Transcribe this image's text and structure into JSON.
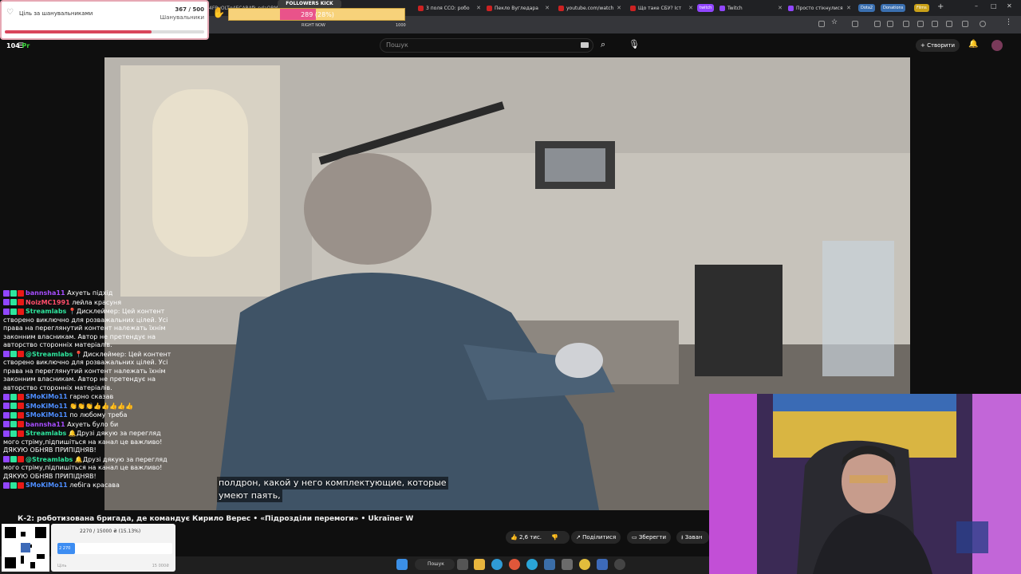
{
  "tabs": [
    {
      "label": "3 поля ССО: робо",
      "color": "#cc2222"
    },
    {
      "label": "Пекло Вугледара",
      "color": "#cc2222"
    },
    {
      "label": "youtube.com/watch",
      "color": "#cc2222"
    },
    {
      "label": "Що таке СБУ? Іст",
      "color": "#cc2222"
    },
    {
      "label": "Twitch",
      "color": "#9146ff"
    },
    {
      "label": "Просто стікнулися",
      "color": "#9146ff"
    }
  ],
  "tab_pills": [
    {
      "label": "twitch",
      "color": "#9146ff"
    },
    {
      "label": "Dota2",
      "color": "#3a6fb0"
    },
    {
      "label": "Donations",
      "color": "#3a6fb0"
    },
    {
      "label": "Films",
      "color": "#c9a018"
    }
  ],
  "address": {
    "url": "4FByOLTg4ECABAfk-ndaQBMf_5x8"
  },
  "youtube": {
    "search_placeholder": "Пошук",
    "create_label": "+ Створити",
    "video_title": "К-2: роботизована бригада, де командує Кирило Верес • «Підрозділи перемоги» • Ukraїner W",
    "subtitle_line1": "полдрон, какой у него комплектующие, которые",
    "subtitle_line2": "умеют паять,",
    "like_count": "2,6 тис.",
    "share_label": "Поділитися",
    "save_label": "Зберегти",
    "download_label": "Заван"
  },
  "goal_widget": {
    "title": "Ціль за шанувальниками",
    "count": "367 / 500",
    "subtitle": "Шанувальники",
    "progress": 0.734
  },
  "followers_kick": {
    "label": "FOLLOWERS KICK",
    "value_text": "289 (28%)",
    "right_now": "RIGHT NOW",
    "max": "1000",
    "progress": 0.289
  },
  "counter": {
    "number": "104",
    "suffix": "Pr"
  },
  "chat": [
    {
      "user": "bannsha11",
      "color": "#a64dff",
      "text": "Ахуеть підхід"
    },
    {
      "user": "NoizMC1991",
      "color": "#ff4d6a",
      "text": "лейла красуня"
    },
    {
      "user": "Streamlabs",
      "color": "#2ee59d",
      "text": "📍Дисклеймер: Цей контент створено виключно для розважальних цілей. Усі права на переглянутий контент належать їхнім законним власникам. Автор не претендує на авторство сторонніх матеріалів."
    },
    {
      "user": "@Streamlabs",
      "color": "#2ee59d",
      "text": "📍Дисклеймер: Цей контент створено виключно для розважальних цілей. Усі права на переглянутий контент належать їхнім законним власникам. Автор не претендує на авторство сторонніх матеріалів."
    },
    {
      "user": "SMoKiMo11",
      "color": "#4d8dff",
      "text": "гарно сказав"
    },
    {
      "user": "SMoKiMo11",
      "color": "#4d8dff",
      "text": "👏👏👏👍👍👍👍👍"
    },
    {
      "user": "SMoKiMo11",
      "color": "#4d8dff",
      "text": "по любому треба"
    },
    {
      "user": "bannsha11",
      "color": "#a64dff",
      "text": "Ахуеть було би"
    },
    {
      "user": "Streamlabs",
      "color": "#2ee59d",
      "text": "🔔Друзі дякую за перегляд мого стріму,підпишіться на канал це важливо! ДЯКУЮ ОБНЯВ ПРИПІДНЯВ!"
    },
    {
      "user": "@Streamlabs",
      "color": "#2ee59d",
      "text": "🔔Друзі дякую за перегляд мого стріму,підпишіться на канал це важливо! ДЯКУЮ ОБНЯВ ПРИПІДНЯВ!"
    },
    {
      "user": "SMoKiMo11",
      "color": "#4d8dff",
      "text": "лебіга красава"
    }
  ],
  "donation": {
    "text": "2270 / 15000 ₴ (15.13%)",
    "bar_label": "2 270",
    "min_label": "Ціль",
    "max_label": "15 000₴",
    "progress": 0.1513
  },
  "taskbar": {
    "search_label": "Пошук"
  }
}
